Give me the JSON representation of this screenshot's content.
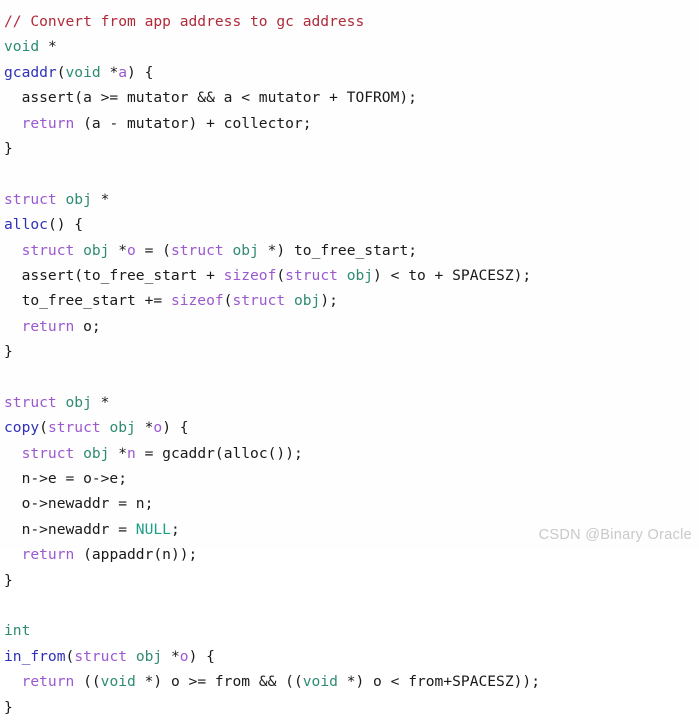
{
  "document": {
    "language": "c",
    "background_color": "#fefefe",
    "default_text_color": "#1a1a1a"
  },
  "palette": {
    "comment": "#b02a3a",
    "type": "#2e8b74",
    "keyword": "#9b59d0",
    "function": "#2e31b8",
    "identifier": "#9b59d0",
    "constant": "#1d9e86",
    "plain": "#1a1a1a",
    "watermark": "#c9c9c9"
  },
  "lines": [
    {
      "id": "l1",
      "text": "// Convert from app address to gc address"
    },
    {
      "id": "l2",
      "text": "void *"
    },
    {
      "id": "l3",
      "text": "gcaddr(void *a) {"
    },
    {
      "id": "l4",
      "text": "  assert(a >= mutator && a < mutator + TOFROM);"
    },
    {
      "id": "l5",
      "text": "  return (a - mutator) + collector;"
    },
    {
      "id": "l6",
      "text": "}"
    },
    {
      "id": "l7",
      "text": ""
    },
    {
      "id": "l8",
      "text": "struct obj *"
    },
    {
      "id": "l9",
      "text": "alloc() {"
    },
    {
      "id": "l10",
      "text": "  struct obj *o = (struct obj *) to_free_start;"
    },
    {
      "id": "l11",
      "text": "  assert(to_free_start + sizeof(struct obj) < to + SPACESZ);"
    },
    {
      "id": "l12",
      "text": "  to_free_start += sizeof(struct obj);"
    },
    {
      "id": "l13",
      "text": "  return o;"
    },
    {
      "id": "l14",
      "text": "}"
    },
    {
      "id": "l15",
      "text": ""
    },
    {
      "id": "l16",
      "text": "struct obj *"
    },
    {
      "id": "l17",
      "text": "copy(struct obj *o) {"
    },
    {
      "id": "l18",
      "text": "  struct obj *n = gcaddr(alloc());"
    },
    {
      "id": "l19",
      "text": "  n->e = o->e;"
    },
    {
      "id": "l20",
      "text": "  o->newaddr = n;"
    },
    {
      "id": "l21",
      "text": "  n->newaddr = NULL;"
    },
    {
      "id": "l22",
      "text": "  return (appaddr(n));"
    },
    {
      "id": "l23",
      "text": "}"
    },
    {
      "id": "l24",
      "text": ""
    },
    {
      "id": "l25",
      "text": "int"
    },
    {
      "id": "l26",
      "text": "in_from(struct obj *o) {"
    },
    {
      "id": "l27",
      "text": "  return ((void *) o >= from && ((void *) o < from+SPACESZ));"
    },
    {
      "id": "l28",
      "text": "}"
    }
  ],
  "watermark": {
    "text": "CSDN @Binary Oracle"
  }
}
